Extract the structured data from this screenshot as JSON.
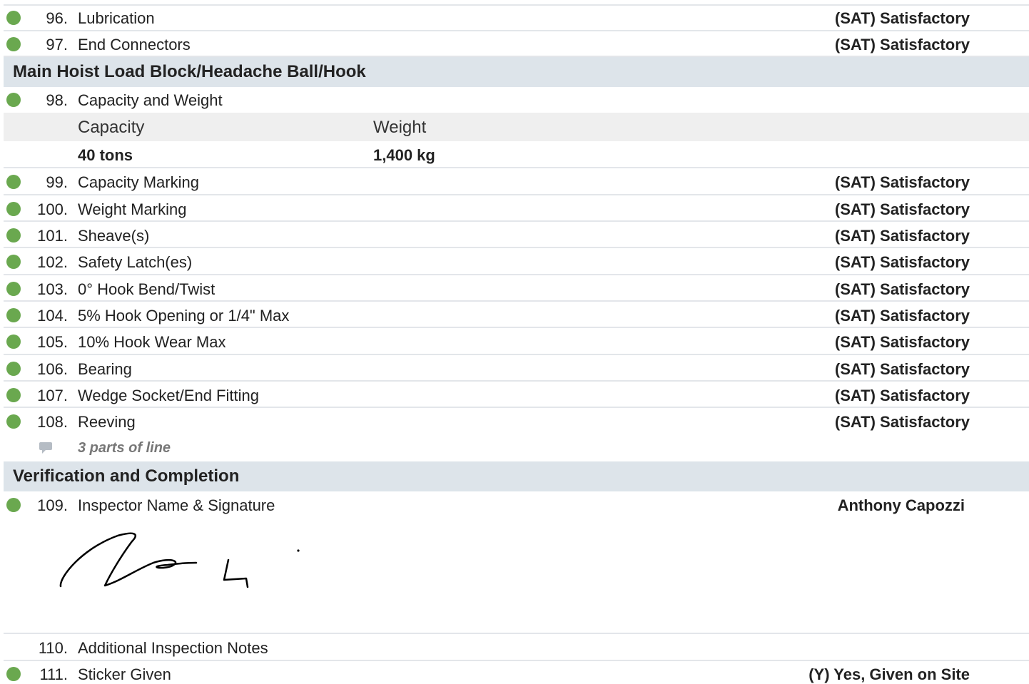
{
  "items_top": [
    {
      "num": "96.",
      "label": "Lubrication",
      "value": "(SAT) Satisfactory"
    },
    {
      "num": "97.",
      "label": "End Connectors",
      "value": "(SAT) Satisfactory"
    }
  ],
  "section_hoist": "Main Hoist Load Block/Headache Ball/Hook",
  "item_98": {
    "num": "98.",
    "label": "Capacity and Weight"
  },
  "capacity_table": {
    "headers": [
      "Capacity",
      "Weight"
    ],
    "values": [
      "40 tons",
      "1,400 kg"
    ]
  },
  "items_mid": [
    {
      "num": "99.",
      "label": "Capacity Marking",
      "value": "(SAT) Satisfactory"
    },
    {
      "num": "100.",
      "label": "Weight Marking",
      "value": "(SAT) Satisfactory"
    },
    {
      "num": "101.",
      "label": "Sheave(s)",
      "value": "(SAT) Satisfactory"
    },
    {
      "num": "102.",
      "label": "Safety Latch(es)",
      "value": "(SAT) Satisfactory"
    },
    {
      "num": "103.",
      "label": "0° Hook Bend/Twist",
      "value": "(SAT) Satisfactory"
    },
    {
      "num": "104.",
      "label": "5% Hook Opening or 1/4\" Max",
      "value": "(SAT) Satisfactory"
    },
    {
      "num": "105.",
      "label": "10% Hook Wear Max",
      "value": "(SAT) Satisfactory"
    },
    {
      "num": "106.",
      "label": "Bearing",
      "value": "(SAT) Satisfactory"
    },
    {
      "num": "107.",
      "label": "Wedge Socket/End Fitting",
      "value": "(SAT) Satisfactory"
    },
    {
      "num": "108.",
      "label": "Reeving",
      "value": "(SAT) Satisfactory"
    }
  ],
  "note_108": "3 parts of line",
  "section_verification": "Verification and Completion",
  "item_109": {
    "num": "109.",
    "label": "Inspector Name & Signature",
    "value": "Anthony Capozzi"
  },
  "item_110": {
    "num": "110.",
    "label": "Additional Inspection Notes"
  },
  "item_111": {
    "num": "111.",
    "label": "Sticker Given",
    "value": "(Y) Yes, Given on Site"
  },
  "colors": {
    "status_green": "#6aa84f",
    "section_bg": "#dde4ea",
    "note_gray": "#777777"
  },
  "icons": {
    "status": "status-dot-icon",
    "comment": "comment-icon"
  }
}
